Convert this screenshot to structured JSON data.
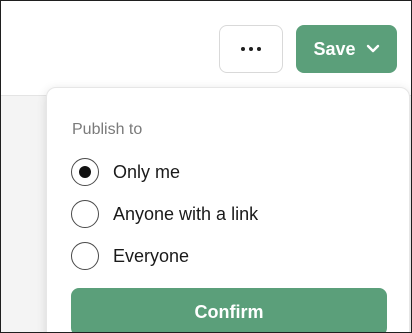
{
  "toolbar": {
    "more_icon": "ellipsis-icon",
    "save_label": "Save",
    "save_icon": "chevron-down-icon"
  },
  "publish_menu": {
    "title": "Publish to",
    "options": [
      {
        "label": "Only me",
        "selected": true
      },
      {
        "label": "Anyone with a link",
        "selected": false
      },
      {
        "label": "Everyone",
        "selected": false
      }
    ],
    "confirm_label": "Confirm"
  },
  "colors": {
    "accent": "#5b9f7a",
    "text": "#1a1a1a",
    "muted": "#7a7a7a",
    "border": "#d9d9d9"
  }
}
